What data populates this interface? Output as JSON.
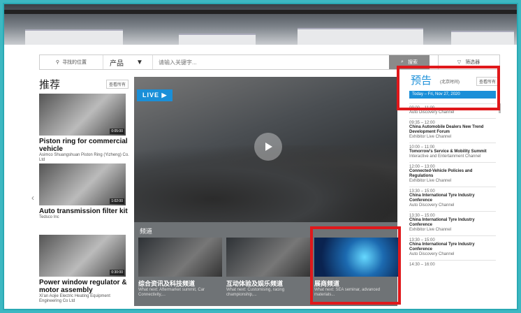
{
  "search": {
    "location_label": "寻找的位置",
    "category_label": "产品",
    "placeholder": "请输入关键字...",
    "search_button": "搜索",
    "filter_button": "筛选器"
  },
  "recommended": {
    "heading": "推荐",
    "see_all": "查看所有",
    "items": [
      {
        "title": "Piston ring for commercial vehicle",
        "company": "Asimco Shuangshuan Piston Ring (Yizheng) Co. Ltd",
        "duration": "0:05:00"
      },
      {
        "title": "Auto transmission filter kit",
        "company": "Tedsco Inc",
        "duration": "1:02:00"
      },
      {
        "title": "Power window regulator & motor assembly",
        "company": "Xi'an Aojie Electric Heating Equipment Engineering Co Ltd",
        "duration": "0:30:00"
      }
    ]
  },
  "player": {
    "live_label": "LIVE ▶"
  },
  "channels": {
    "heading": "频道",
    "items": [
      {
        "title": "综合资讯及科技频道",
        "desc": "What next: Aftermarket summit, Car Connectivity,..."
      },
      {
        "title": "互动体验及娱乐频道",
        "desc": "What next: Customising, racing championship,..."
      },
      {
        "title": "展商频道",
        "desc": "What next: SEA seminar, advanced materials..."
      }
    ]
  },
  "preview": {
    "heading": "预告",
    "timezone": "(北京时间)",
    "see_all": "查看所有",
    "today": "Today – Fri, Nov 27, 2020",
    "events": [
      {
        "time": "09:00 – 11:00",
        "name": "",
        "channel": "Auto Discovery Channel"
      },
      {
        "time": "09:35 – 12:00",
        "name": "China Automobile Dealers New Trend Development Forum",
        "channel": "Exhibitor Live Channel"
      },
      {
        "time": "10:00 – 11:00",
        "name": "Tomorrow's Service & Mobility Summit",
        "channel": "Interactive and Entertainment Channel"
      },
      {
        "time": "12:00 – 13:00",
        "name": "Connected-Vehicle Policies and Regulations",
        "channel": "Exhibitor Live Channel"
      },
      {
        "time": "13:30 – 15:00",
        "name": "China International Tyre Industry Conference",
        "channel": "Auto Discovery Channel"
      },
      {
        "time": "13:30 – 15:00",
        "name": "China International Tyre Industry Conference",
        "channel": "Exhibitor Live Channel"
      },
      {
        "time": "13:30 – 15:00",
        "name": "China International Tyre Industry Conference",
        "channel": "Auto Discovery Channel"
      },
      {
        "time": "14:30 – 16:00",
        "name": "",
        "channel": ""
      }
    ]
  },
  "colors": {
    "accent": "#1a8fd8",
    "highlight": "#e0181b",
    "frame": "#2aa9b4"
  }
}
